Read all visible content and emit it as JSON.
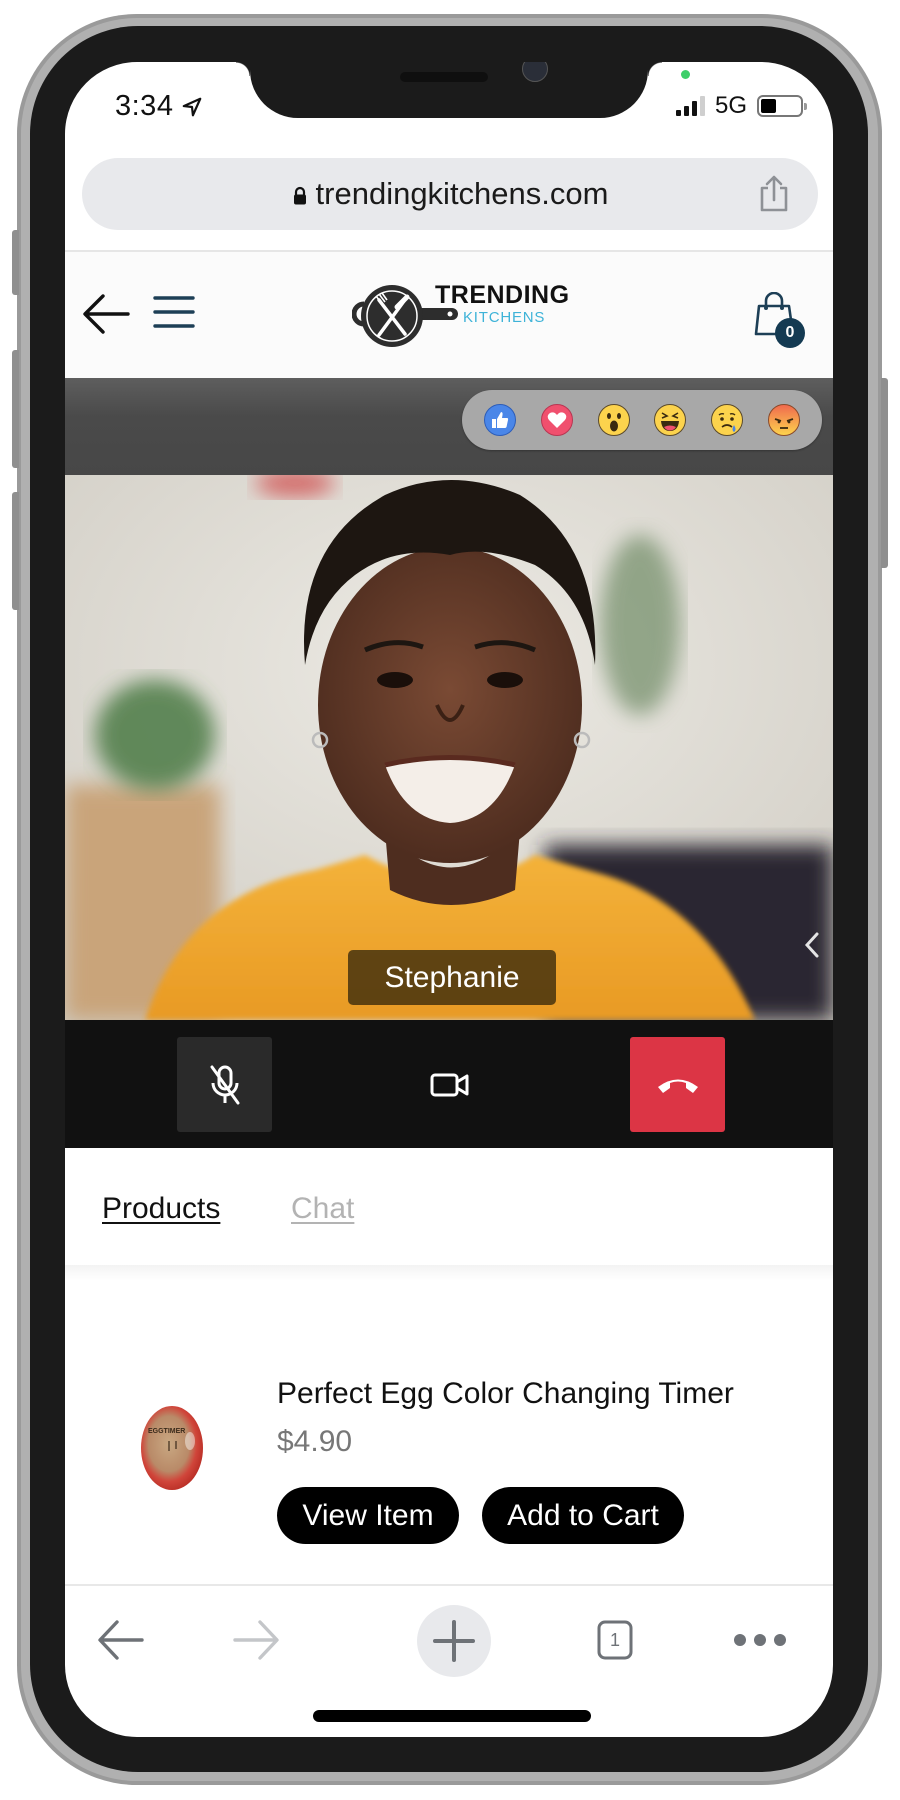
{
  "status_bar": {
    "time": "3:34",
    "network": "5G",
    "battery_level": 0.4,
    "signal_bars_active": 3,
    "signal_bars_total": 4
  },
  "browser": {
    "url": "trendingkitchens.com",
    "tab_count": "1"
  },
  "site_header": {
    "logo_line1": "TRENDING",
    "logo_line2": "KITCHENS",
    "cart_count": "0"
  },
  "reactions": [
    "like",
    "love",
    "wow",
    "haha",
    "sad",
    "angry"
  ],
  "video_call": {
    "participant_name": "Stephanie",
    "mic_muted": true
  },
  "colors": {
    "hangup": "#dc3545",
    "brand_accent": "#3eb3d8",
    "cart_badge": "#143a52"
  },
  "tabs": [
    {
      "label": "Products",
      "active": true
    },
    {
      "label": "Chat",
      "active": false
    }
  ],
  "products": [
    {
      "title": "Perfect Egg Color Changing Timer",
      "price": "$4.90",
      "view_label": "View Item",
      "add_label": "Add to Cart"
    }
  ]
}
